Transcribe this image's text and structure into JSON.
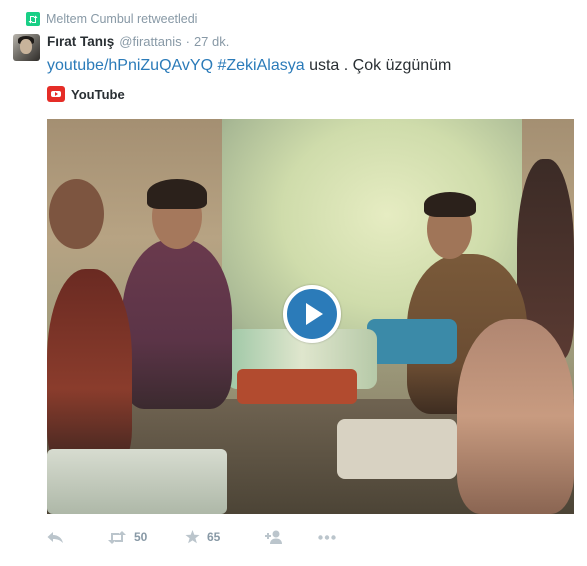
{
  "retweet_context": {
    "text": "Meltem Cumbul retweetledi"
  },
  "author": {
    "display_name": "Fırat Tanış",
    "username": "@firattanis",
    "separator": "·",
    "time": "27 dk."
  },
  "tweet": {
    "link": "youtube/hPniZuQAvYQ",
    "hashtag": "#ZekiAlasya",
    "text": " usta . Çok üzgünüm"
  },
  "card": {
    "source": "YouTube"
  },
  "actions": {
    "retweet_count": "50",
    "favorite_count": "65"
  },
  "colors": {
    "link": "#2b7bb9",
    "retweet_green": "#19cf86",
    "youtube_red": "#e52d27",
    "muted": "#8899a6",
    "icon": "#bbc5cc"
  },
  "icons": {
    "retweet_context": "retweet-icon",
    "youtube": "youtube-logo-icon",
    "play": "play-icon",
    "reply": "reply-icon",
    "retweet": "retweet-icon",
    "favorite": "star-icon",
    "follow": "add-user-icon",
    "more": "more-icon"
  }
}
